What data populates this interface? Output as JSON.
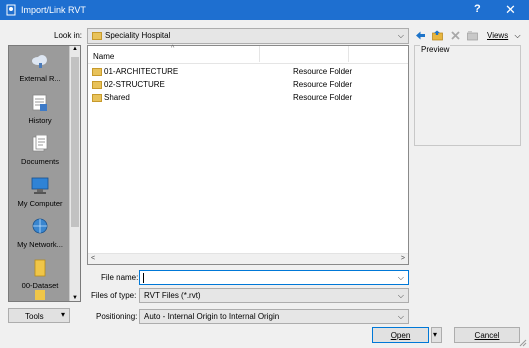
{
  "window": {
    "title": "Import/Link RVT",
    "help_glyph": "?",
    "close_glyph": "✕"
  },
  "look_in": {
    "label": "Look in:",
    "value": "Speciality Hospital"
  },
  "toolbar": {
    "views_label": "Views"
  },
  "places": [
    {
      "label": "External R...",
      "icon": "cloud-icon"
    },
    {
      "label": "History",
      "icon": "history-icon"
    },
    {
      "label": "Documents",
      "icon": "documents-icon"
    },
    {
      "label": "My Computer",
      "icon": "computer-icon"
    },
    {
      "label": "My Network...",
      "icon": "network-icon"
    },
    {
      "label": "00-Dataset",
      "icon": "folder-icon"
    }
  ],
  "file_list": {
    "columns": [
      "Name"
    ],
    "rows": [
      {
        "name": "01-ARCHITECTURE",
        "type": "Resource Folder"
      },
      {
        "name": "02-STRUCTURE",
        "type": "Resource Folder"
      },
      {
        "name": "Shared",
        "type": "Resource Folder"
      }
    ]
  },
  "preview": {
    "label": "Preview"
  },
  "file_name": {
    "label": "File name:",
    "value": ""
  },
  "files_of_type": {
    "label": "Files of type:",
    "value": "RVT Files  (*.rvt)"
  },
  "positioning": {
    "label": "Positioning:",
    "value": "Auto - Internal Origin to Internal Origin"
  },
  "buttons": {
    "tools": "Tools",
    "open": "Open",
    "cancel": "Cancel"
  },
  "colors": {
    "titlebar": "#1e6fd0",
    "places_bg": "#9b9b9b",
    "folder": "#e8c25a"
  }
}
